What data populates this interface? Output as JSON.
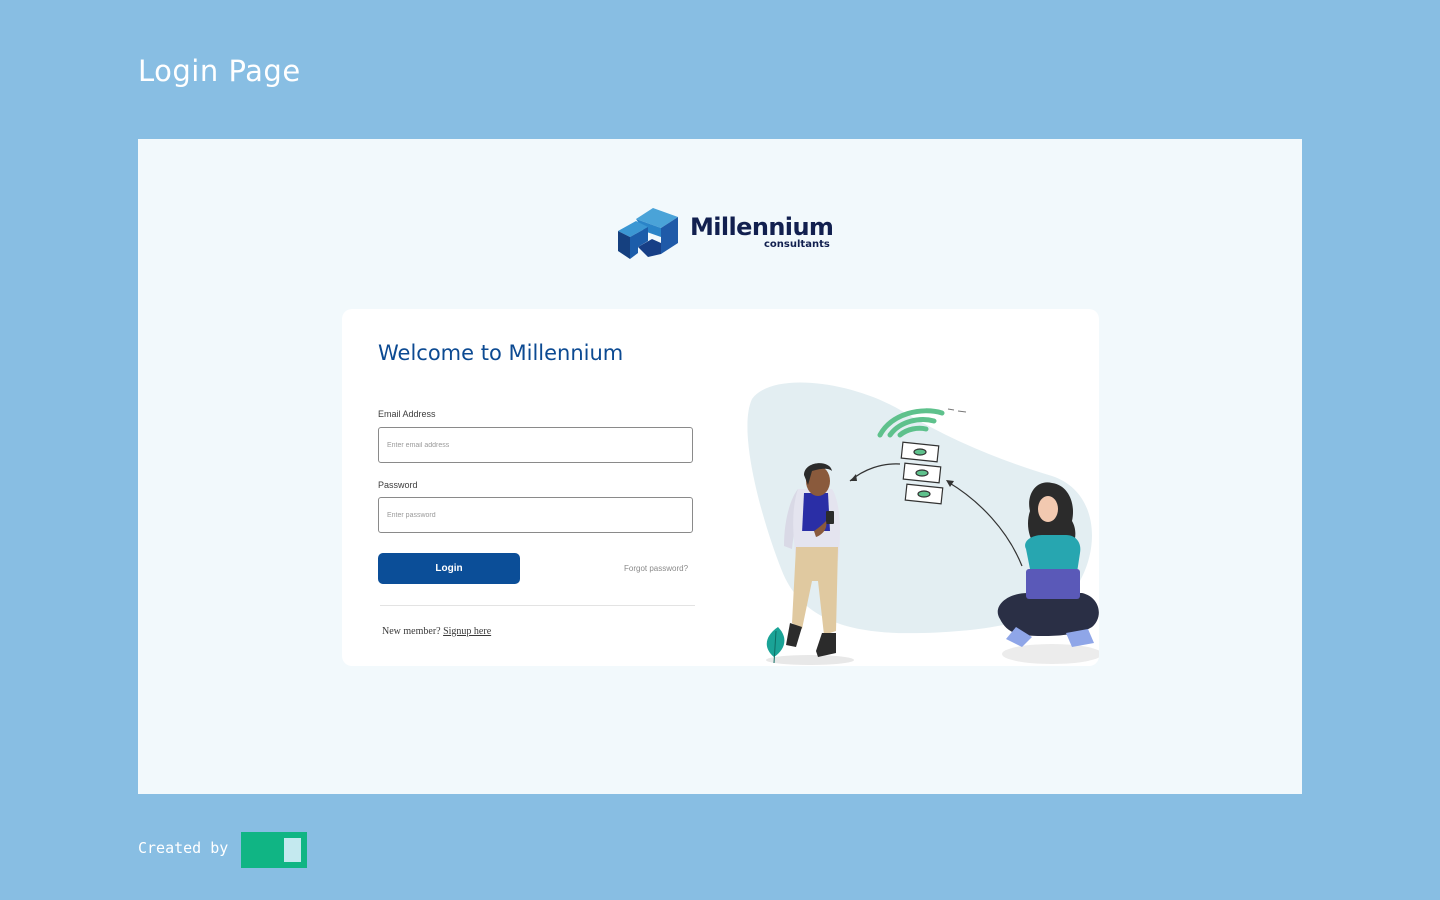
{
  "page": {
    "heading": "Login Page"
  },
  "logo": {
    "name": "Millennium",
    "subtitle": "consultants"
  },
  "login_card": {
    "title": "Welcome to Millennium",
    "email": {
      "label": "Email Address",
      "placeholder": "Enter email address",
      "value": ""
    },
    "password": {
      "label": "Password",
      "placeholder": "Enter password",
      "value": ""
    },
    "login_button": "Login",
    "forgot_password": "Forgot password?",
    "signup_prompt": "New member?",
    "signup_link": "Signup here"
  },
  "footer": {
    "credit": "Created by"
  },
  "colors": {
    "page_background": "#88bee3",
    "canvas_background": "#f2f9fc",
    "primary": "#0b4e98",
    "title": "#0c4a92",
    "brand_green": "#10b584",
    "illustration_accent": "#5ec18c"
  },
  "icons": [
    "millennium-logo-icon",
    "people-money-transfer-illustration",
    "brand-mark-icon"
  ]
}
